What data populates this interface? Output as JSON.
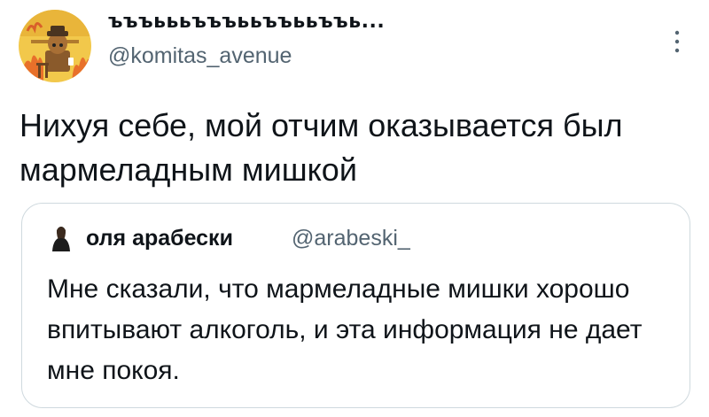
{
  "tweet": {
    "author": {
      "display_name": "ъъъьььъъъььъъььъъь...",
      "handle": "@komitas_avenue",
      "avatar": "this-is-fine-dog-avatar"
    },
    "more_icon": "more-vertical-icon",
    "text": "Нихуя себе, мой отчим оказывается был мармеладным мишкой"
  },
  "quote": {
    "author": {
      "display_name": "оля арабески",
      "handle": "@arabeski_",
      "avatar": "person-silhouette-avatar"
    },
    "text": "Мне сказали, что мармеладные мишки хорошо впитывают алкоголь, и эта информация не дает мне покоя."
  },
  "colors": {
    "text_primary": "#0f1419",
    "text_secondary": "#536471",
    "border": "#cfd9de",
    "background": "#ffffff"
  }
}
